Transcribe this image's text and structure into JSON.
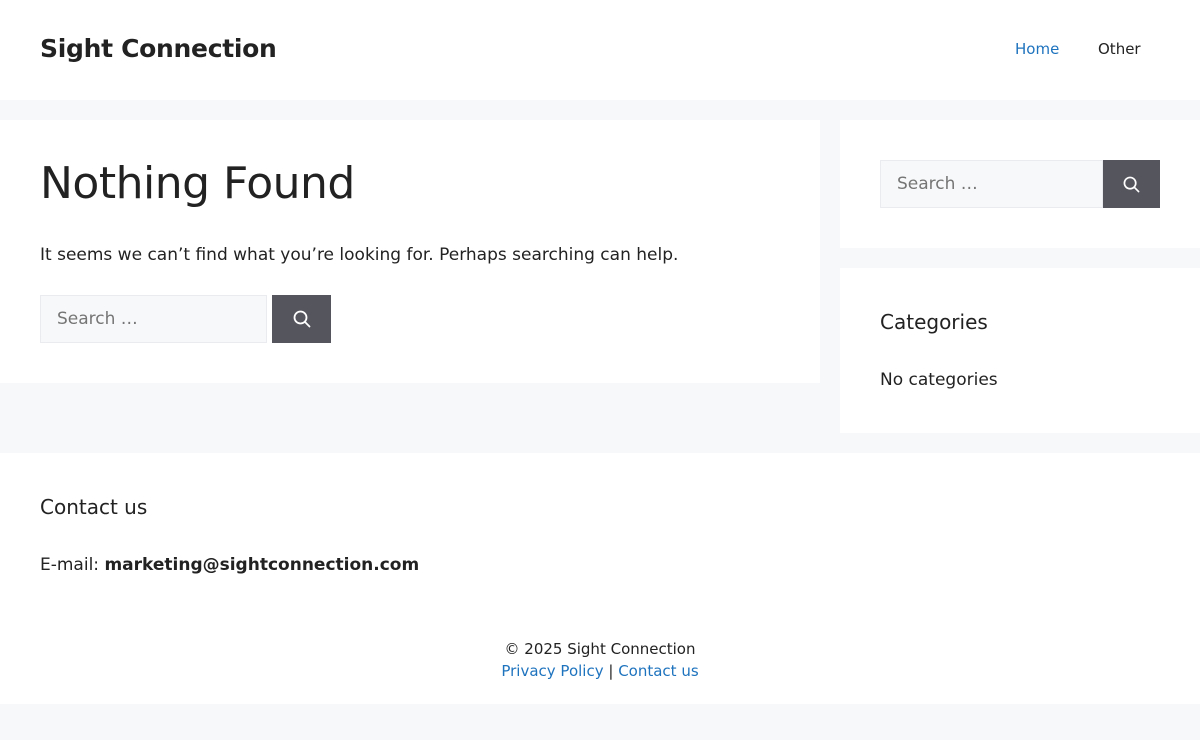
{
  "header": {
    "site_title": "Sight Connection",
    "nav": [
      {
        "label": "Home",
        "active": true
      },
      {
        "label": "Other",
        "active": false
      }
    ]
  },
  "main": {
    "title": "Nothing Found",
    "message": "It seems we can’t find what you’re looking for. Perhaps searching can help.",
    "search": {
      "placeholder": "Search …",
      "value": "",
      "button_icon": "search-icon"
    }
  },
  "sidebar": {
    "search": {
      "placeholder": "Search …",
      "value": "",
      "button_icon": "search-icon"
    },
    "categories": {
      "title": "Categories",
      "empty_text": "No categories"
    }
  },
  "footer": {
    "contact_title": "Contact us",
    "email_label": "E-mail: ",
    "email": "marketing@sightconnection.com",
    "copyright": "© 2025 Sight Connection",
    "links": [
      {
        "label": "Privacy Policy"
      },
      {
        "label": "Contact us"
      }
    ],
    "link_separator": " | "
  },
  "colors": {
    "link": "#1e73be",
    "button": "#55555e",
    "background": "#f7f8f9",
    "text": "#222222"
  }
}
